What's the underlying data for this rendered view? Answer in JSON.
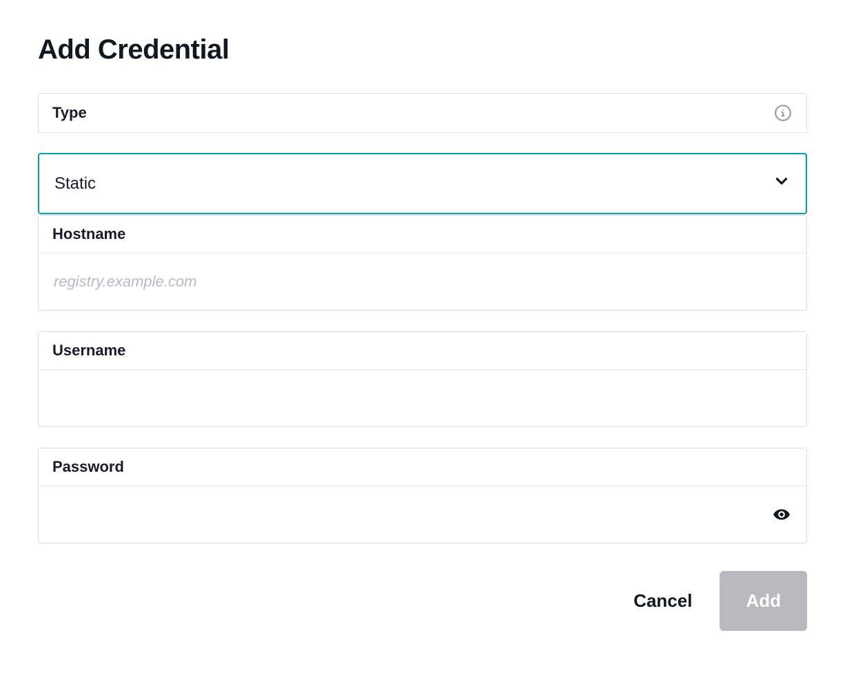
{
  "title": "Add Credential",
  "fields": {
    "type": {
      "label": "Type",
      "value": "Static"
    },
    "hostname": {
      "label": "Hostname",
      "placeholder": "registry.example.com",
      "value": ""
    },
    "username": {
      "label": "Username",
      "placeholder": "",
      "value": ""
    },
    "password": {
      "label": "Password",
      "placeholder": "",
      "value": ""
    }
  },
  "actions": {
    "cancel": "Cancel",
    "add": "Add"
  }
}
